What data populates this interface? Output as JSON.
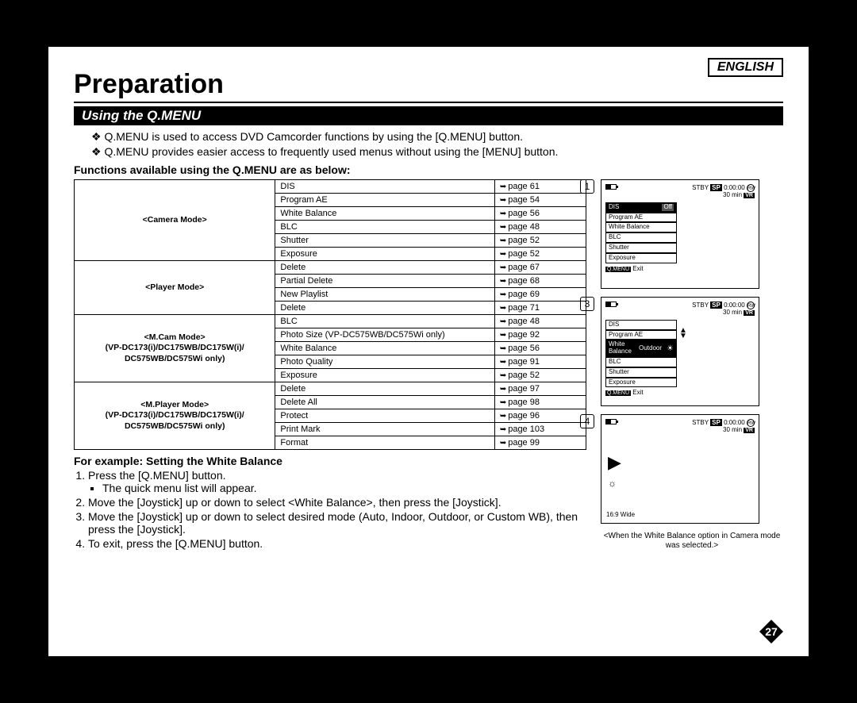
{
  "lang": "ENGLISH",
  "title": "Preparation",
  "section": "Using the Q.MENU",
  "intro": [
    "Q.MENU is used to access DVD Camcorder functions by using the [Q.MENU] button.",
    "Q.MENU provides easier access to frequently used menus without using the [MENU] button."
  ],
  "funcHeading": "Functions available using the Q.MENU are as below:",
  "modes": [
    {
      "label": "<Camera Mode>",
      "rows": [
        {
          "fn": "DIS",
          "pg": "page 61"
        },
        {
          "fn": "Program AE",
          "pg": "page 54"
        },
        {
          "fn": "White Balance",
          "pg": "page 56"
        },
        {
          "fn": "BLC",
          "pg": "page 48"
        },
        {
          "fn": "Shutter",
          "pg": "page 52"
        },
        {
          "fn": "Exposure",
          "pg": "page 52"
        }
      ]
    },
    {
      "label": "<Player Mode>",
      "rows": [
        {
          "fn": "Delete",
          "pg": "page 67"
        },
        {
          "fn": "Partial Delete",
          "pg": "page 68"
        },
        {
          "fn": "New Playlist",
          "pg": "page 69"
        },
        {
          "fn": "Delete",
          "pg": "page 71"
        }
      ],
      "splitAfter": 2
    },
    {
      "label": "<M.Cam Mode>\n(VP-DC173(i)/DC175WB/DC175W(i)/\nDC575WB/DC575Wi only)",
      "rows": [
        {
          "fn": "BLC",
          "pg": "page 48"
        },
        {
          "fn": "Photo Size (VP-DC575WB/DC575Wi only)",
          "pg": "page 92"
        },
        {
          "fn": "White Balance",
          "pg": "page 56"
        },
        {
          "fn": "Photo Quality",
          "pg": "page 91"
        },
        {
          "fn": "Exposure",
          "pg": "page 52"
        }
      ]
    },
    {
      "label": "<M.Player Mode>\n(VP-DC173(i)/DC175WB/DC175W(i)/\nDC575WB/DC575Wi only)",
      "rows": [
        {
          "fn": "Delete",
          "pg": "page 97"
        },
        {
          "fn": "Delete All",
          "pg": "page 98"
        },
        {
          "fn": "Protect",
          "pg": "page 96"
        },
        {
          "fn": "Print Mark",
          "pg": "page 103"
        },
        {
          "fn": "Format",
          "pg": "page 99"
        }
      ]
    }
  ],
  "example": {
    "heading": "For example: Setting the White Balance",
    "steps": [
      {
        "text": "Press the [Q.MENU] button.",
        "sub": [
          "The quick menu list will appear."
        ]
      },
      {
        "text": "Move the [Joystick] up or down to select <White Balance>, then press the [Joystick]."
      },
      {
        "text": "Move the [Joystick] up or down to select desired mode (Auto, Indoor, Outdoor, or Custom WB), then press the [Joystick]."
      },
      {
        "text": "To exit, press the [Q.MENU] button."
      }
    ]
  },
  "screens": {
    "s1": {
      "num": "1",
      "stby": "STBY",
      "sp": "SP",
      "time": "0:00:00",
      "rw": "RW",
      "min": "30 min",
      "vr": "VR",
      "items": [
        "DIS",
        "Program AE",
        "White Balance",
        "BLC",
        "Shutter",
        "Exposure"
      ],
      "selIdx": 0,
      "selVal": "Off",
      "exit": "Exit",
      "qm": "Q.MENU"
    },
    "s3": {
      "num": "3",
      "stby": "STBY",
      "sp": "SP",
      "time": "0:00:00",
      "rw": "RW",
      "min": "30 min",
      "vr": "VR",
      "items": [
        "DIS",
        "Program AE",
        "White Balance",
        "BLC",
        "Shutter",
        "Exposure"
      ],
      "selIdx": 2,
      "selVal": "Outdoor",
      "exit": "Exit",
      "qm": "Q.MENU"
    },
    "s4": {
      "num": "4",
      "stby": "STBY",
      "sp": "SP",
      "time": "0:00:00",
      "rw": "RW",
      "min": "30 min",
      "vr": "VR",
      "ratio": "16:9 Wide"
    },
    "caption": "<When the White Balance option in Camera mode was selected.>"
  },
  "pageNumber": "27"
}
